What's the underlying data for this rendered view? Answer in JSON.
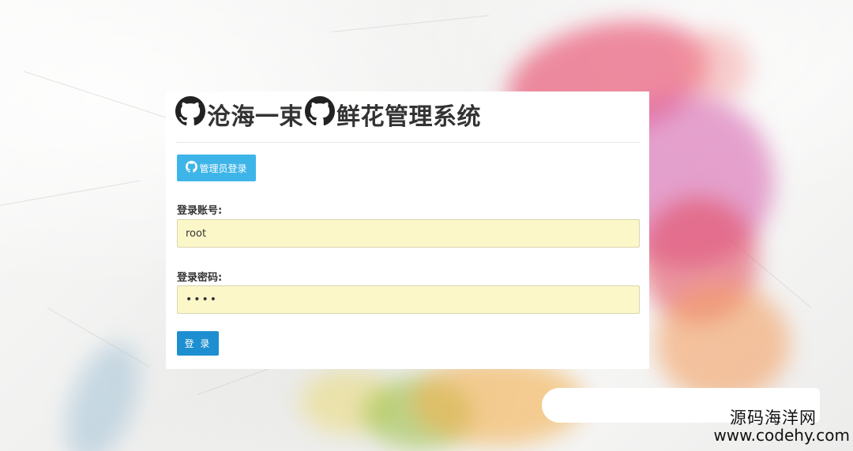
{
  "page": {
    "title_part1": "沧海一束",
    "title_part2": "鲜花管理系统",
    "icons": [
      "github-icon",
      "github-icon"
    ]
  },
  "login": {
    "tab_label": "管理员登录",
    "tab_icon": "github-icon",
    "account_label": "登录账号:",
    "account_value": "root",
    "password_label": "登录密码:",
    "password_value": "••••",
    "submit_label": "登 录"
  },
  "watermark": {
    "site_name": "源码海洋网",
    "url": "www.codehy.com"
  },
  "colors": {
    "admin_button": "#3eb5e8",
    "login_button": "#1d8fd0",
    "input_background": "#fcf7c9",
    "title_text": "#333333"
  }
}
